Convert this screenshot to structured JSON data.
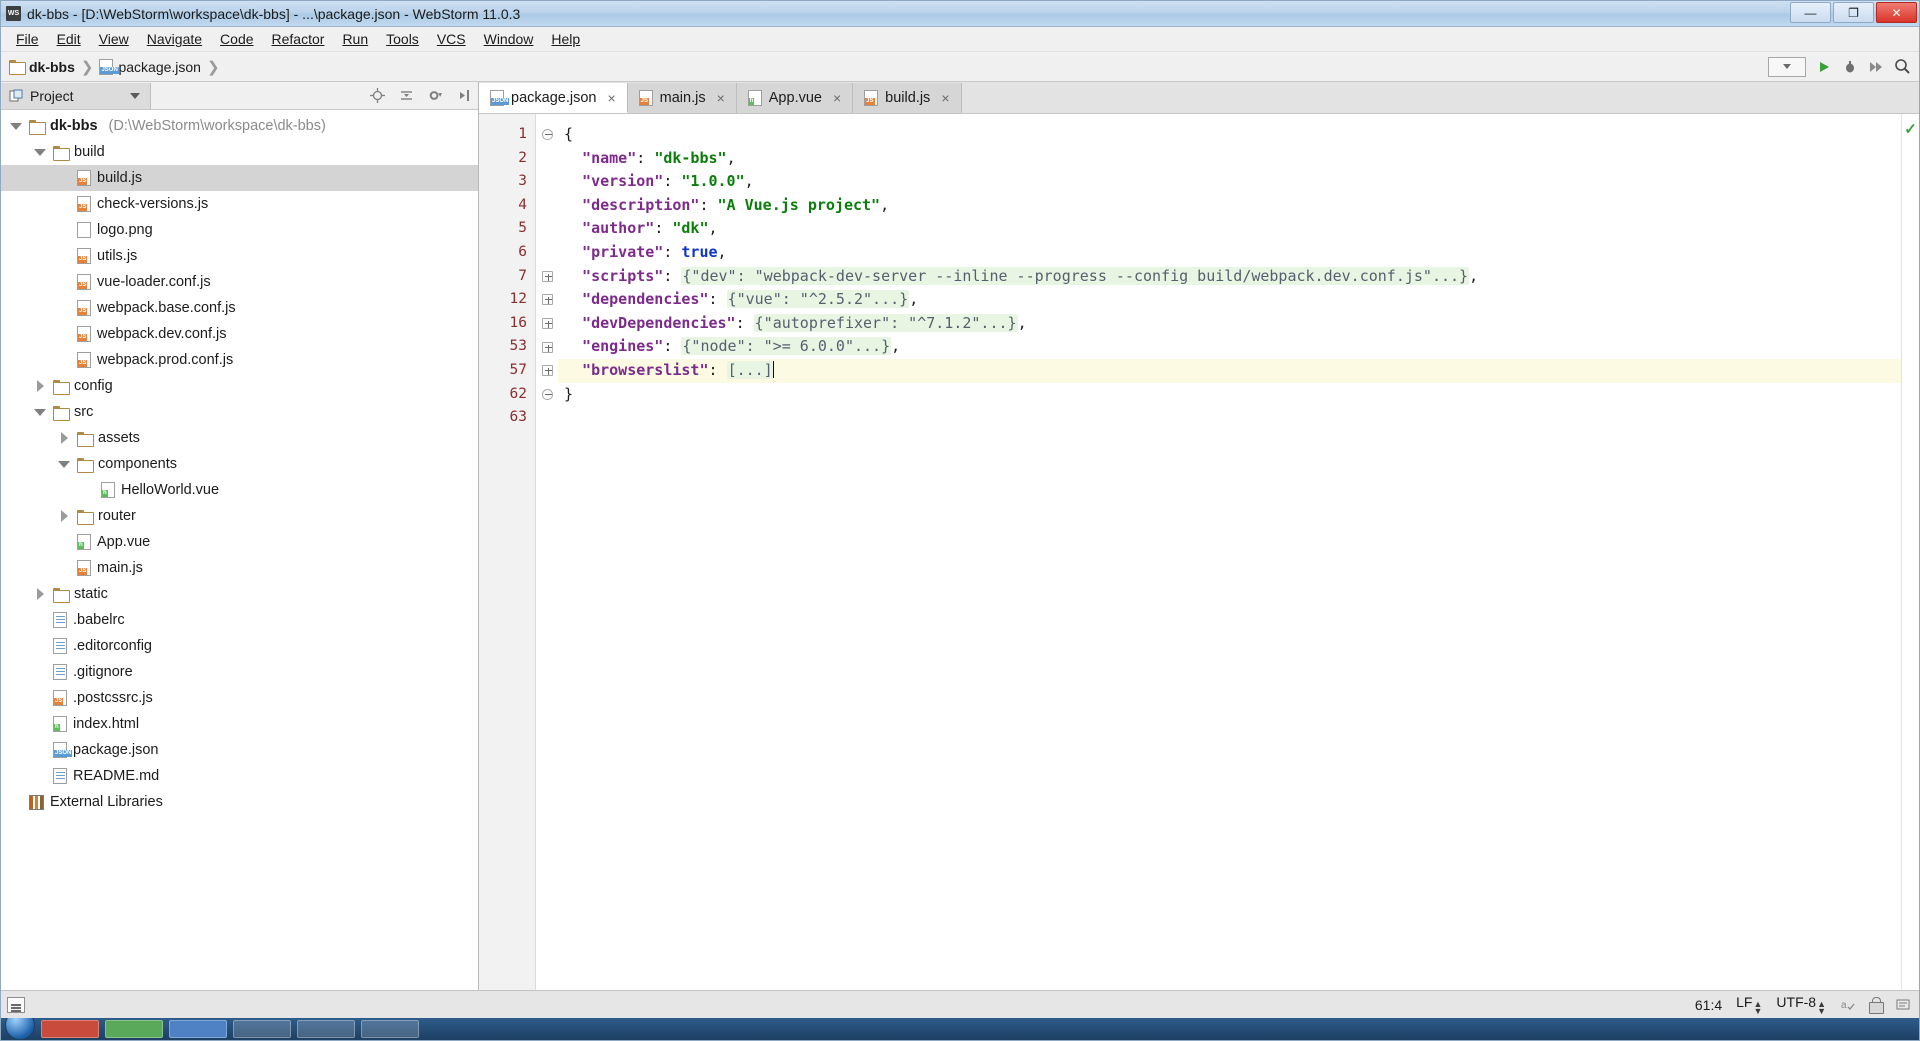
{
  "window": {
    "title": "dk-bbs - [D:\\WebStorm\\workspace\\dk-bbs] - ...\\package.json - WebStorm 11.0.3",
    "logo_text": "WS",
    "minimize_label": "—",
    "maximize_label": "❐",
    "close_label": "✕"
  },
  "menu": {
    "items": [
      {
        "label": "File"
      },
      {
        "label": "Edit"
      },
      {
        "label": "View"
      },
      {
        "label": "Navigate"
      },
      {
        "label": "Code"
      },
      {
        "label": "Refactor"
      },
      {
        "label": "Run"
      },
      {
        "label": "Tools"
      },
      {
        "label": "VCS"
      },
      {
        "label": "Window"
      },
      {
        "label": "Help"
      }
    ]
  },
  "navbar": {
    "crumbs": [
      {
        "label": "dk-bbs",
        "icon": "folder-icon"
      },
      {
        "label": "package.json",
        "icon": "json-file-icon"
      }
    ],
    "separator": "❯",
    "search_icon": "search-icon",
    "run_icon": "run-icon",
    "debug_icon": "debug-icon",
    "coverage_icon": "coverage-icon"
  },
  "project_panel": {
    "tab_label": "Project",
    "header_icons": [
      "target-icon",
      "collapse-all-icon",
      "settings-icon",
      "hide-icon"
    ],
    "tree": [
      {
        "label": "dk-bbs",
        "path": "(D:\\WebStorm\\workspace\\dk-bbs)",
        "indent": 0,
        "twisty": "down",
        "icon": "folder-icon",
        "bold": true,
        "selected": false
      },
      {
        "label": "build",
        "path": "",
        "indent": 1,
        "twisty": "down",
        "icon": "folder-icon",
        "bold": false,
        "selected": false
      },
      {
        "label": "build.js",
        "path": "",
        "indent": 2,
        "twisty": "none",
        "icon": "js-file-icon",
        "bold": false,
        "selected": true
      },
      {
        "label": "check-versions.js",
        "path": "",
        "indent": 2,
        "twisty": "none",
        "icon": "js-file-icon",
        "bold": false,
        "selected": false
      },
      {
        "label": "logo.png",
        "path": "",
        "indent": 2,
        "twisty": "none",
        "icon": "png-file-icon",
        "bold": false,
        "selected": false
      },
      {
        "label": "utils.js",
        "path": "",
        "indent": 2,
        "twisty": "none",
        "icon": "js-file-icon",
        "bold": false,
        "selected": false
      },
      {
        "label": "vue-loader.conf.js",
        "path": "",
        "indent": 2,
        "twisty": "none",
        "icon": "js-file-icon",
        "bold": false,
        "selected": false
      },
      {
        "label": "webpack.base.conf.js",
        "path": "",
        "indent": 2,
        "twisty": "none",
        "icon": "js-file-icon",
        "bold": false,
        "selected": false
      },
      {
        "label": "webpack.dev.conf.js",
        "path": "",
        "indent": 2,
        "twisty": "none",
        "icon": "js-file-icon",
        "bold": false,
        "selected": false
      },
      {
        "label": "webpack.prod.conf.js",
        "path": "",
        "indent": 2,
        "twisty": "none",
        "icon": "js-file-icon",
        "bold": false,
        "selected": false
      },
      {
        "label": "config",
        "path": "",
        "indent": 1,
        "twisty": "right",
        "icon": "folder-icon",
        "bold": false,
        "selected": false
      },
      {
        "label": "src",
        "path": "",
        "indent": 1,
        "twisty": "down",
        "icon": "folder-icon",
        "bold": false,
        "selected": false
      },
      {
        "label": "assets",
        "path": "",
        "indent": 2,
        "twisty": "right",
        "icon": "folder-icon",
        "bold": false,
        "selected": false
      },
      {
        "label": "components",
        "path": "",
        "indent": 2,
        "twisty": "down",
        "icon": "folder-icon",
        "bold": false,
        "selected": false
      },
      {
        "label": "HelloWorld.vue",
        "path": "",
        "indent": 3,
        "twisty": "none",
        "icon": "vue-file-icon",
        "bold": false,
        "selected": false
      },
      {
        "label": "router",
        "path": "",
        "indent": 2,
        "twisty": "right",
        "icon": "folder-icon",
        "bold": false,
        "selected": false
      },
      {
        "label": "App.vue",
        "path": "",
        "indent": 2,
        "twisty": "none",
        "icon": "vue-file-icon",
        "bold": false,
        "selected": false
      },
      {
        "label": "main.js",
        "path": "",
        "indent": 2,
        "twisty": "none",
        "icon": "js-file-icon",
        "bold": false,
        "selected": false
      },
      {
        "label": "static",
        "path": "",
        "indent": 1,
        "twisty": "right",
        "icon": "folder-icon",
        "bold": false,
        "selected": false
      },
      {
        "label": ".babelrc",
        "path": "",
        "indent": 1,
        "twisty": "none",
        "icon": "text-file-icon",
        "bold": false,
        "selected": false
      },
      {
        "label": ".editorconfig",
        "path": "",
        "indent": 1,
        "twisty": "none",
        "icon": "text-file-icon",
        "bold": false,
        "selected": false
      },
      {
        "label": ".gitignore",
        "path": "",
        "indent": 1,
        "twisty": "none",
        "icon": "text-file-icon",
        "bold": false,
        "selected": false
      },
      {
        "label": ".postcssrc.js",
        "path": "",
        "indent": 1,
        "twisty": "none",
        "icon": "js-file-icon",
        "bold": false,
        "selected": false
      },
      {
        "label": "index.html",
        "path": "",
        "indent": 1,
        "twisty": "none",
        "icon": "html-file-icon",
        "bold": false,
        "selected": false
      },
      {
        "label": "package.json",
        "path": "",
        "indent": 1,
        "twisty": "none",
        "icon": "json-file-icon",
        "bold": false,
        "selected": false
      },
      {
        "label": "README.md",
        "path": "",
        "indent": 1,
        "twisty": "none",
        "icon": "text-file-icon",
        "bold": false,
        "selected": false
      },
      {
        "label": "External Libraries",
        "path": "",
        "indent": 0,
        "twisty": "none",
        "icon": "library-icon",
        "bold": false,
        "selected": false
      }
    ]
  },
  "editor": {
    "tabs": [
      {
        "label": "package.json",
        "icon": "json-file-icon",
        "active": true,
        "close": "×"
      },
      {
        "label": "main.js",
        "icon": "js-file-icon",
        "active": false,
        "close": "×"
      },
      {
        "label": "App.vue",
        "icon": "vue-file-icon",
        "active": false,
        "close": "×"
      },
      {
        "label": "build.js",
        "icon": "js-file-icon",
        "active": false,
        "close": "×"
      }
    ],
    "inspection_status": "✓",
    "lines": [
      {
        "num": "1",
        "fold": "minus",
        "caret_line": false,
        "tokens": [
          {
            "t": "{",
            "c": "p"
          }
        ]
      },
      {
        "num": "2",
        "fold": "none",
        "caret_line": false,
        "tokens": [
          {
            "t": "  \"name\"",
            "c": "k"
          },
          {
            "t": ": ",
            "c": "p"
          },
          {
            "t": "\"dk-bbs\"",
            "c": "s"
          },
          {
            "t": ",",
            "c": "p"
          }
        ]
      },
      {
        "num": "3",
        "fold": "none",
        "caret_line": false,
        "tokens": [
          {
            "t": "  \"version\"",
            "c": "k"
          },
          {
            "t": ": ",
            "c": "p"
          },
          {
            "t": "\"1.0.0\"",
            "c": "s"
          },
          {
            "t": ",",
            "c": "p"
          }
        ]
      },
      {
        "num": "4",
        "fold": "none",
        "caret_line": false,
        "tokens": [
          {
            "t": "  \"description\"",
            "c": "k"
          },
          {
            "t": ": ",
            "c": "p"
          },
          {
            "t": "\"A Vue.js project\"",
            "c": "s"
          },
          {
            "t": ",",
            "c": "p"
          }
        ]
      },
      {
        "num": "5",
        "fold": "none",
        "caret_line": false,
        "tokens": [
          {
            "t": "  \"author\"",
            "c": "k"
          },
          {
            "t": ": ",
            "c": "p"
          },
          {
            "t": "\"dk\"",
            "c": "s"
          },
          {
            "t": ",",
            "c": "p"
          }
        ]
      },
      {
        "num": "6",
        "fold": "none",
        "caret_line": false,
        "tokens": [
          {
            "t": "  \"private\"",
            "c": "k"
          },
          {
            "t": ": ",
            "c": "p"
          },
          {
            "t": "true",
            "c": "b"
          },
          {
            "t": ",",
            "c": "p"
          }
        ]
      },
      {
        "num": "7",
        "fold": "plus",
        "caret_line": false,
        "tokens": [
          {
            "t": "  \"scripts\"",
            "c": "k"
          },
          {
            "t": ": ",
            "c": "p"
          },
          {
            "t": "{\"dev\": \"webpack-dev-server --inline --progress --config build/webpack.dev.conf.js\"...}",
            "c": "fold"
          },
          {
            "t": ",",
            "c": "p"
          }
        ]
      },
      {
        "num": "12",
        "fold": "plus",
        "caret_line": false,
        "tokens": [
          {
            "t": "  \"dependencies\"",
            "c": "k"
          },
          {
            "t": ": ",
            "c": "p"
          },
          {
            "t": "{\"vue\": \"^2.5.2\"...}",
            "c": "fold"
          },
          {
            "t": ",",
            "c": "p"
          }
        ]
      },
      {
        "num": "16",
        "fold": "plus",
        "caret_line": false,
        "tokens": [
          {
            "t": "  \"devDependencies\"",
            "c": "k"
          },
          {
            "t": ": ",
            "c": "p"
          },
          {
            "t": "{\"autoprefixer\": \"^7.1.2\"...}",
            "c": "fold"
          },
          {
            "t": ",",
            "c": "p"
          }
        ]
      },
      {
        "num": "53",
        "fold": "plus",
        "caret_line": false,
        "tokens": [
          {
            "t": "  \"engines\"",
            "c": "k"
          },
          {
            "t": ": ",
            "c": "p"
          },
          {
            "t": "{\"node\": \">= 6.0.0\"...}",
            "c": "fold"
          },
          {
            "t": ",",
            "c": "p"
          }
        ]
      },
      {
        "num": "57",
        "fold": "plus",
        "caret_line": true,
        "tokens": [
          {
            "t": "  \"browserslist\"",
            "c": "k"
          },
          {
            "t": ": ",
            "c": "p"
          },
          {
            "t": "[...]",
            "c": "fold"
          }
        ]
      },
      {
        "num": "62",
        "fold": "minus",
        "caret_line": false,
        "tokens": [
          {
            "t": "}",
            "c": "p"
          }
        ]
      },
      {
        "num": "63",
        "fold": "none",
        "caret_line": false,
        "tokens": []
      }
    ]
  },
  "statusbar": {
    "toggle_icon": "toggle-sidebar-icon",
    "caret_position": "61:4",
    "line_separator": "LF",
    "encoding": "UTF-8",
    "spell_icon": "spellcheck-icon",
    "lock_icon": "lock-icon",
    "event_icon": "event-log-icon"
  },
  "colors": {
    "key": "#7d2a8c",
    "string": "#0a7d0a",
    "boolean": "#0f35c8",
    "fold_background": "#e8f5e3",
    "caret_line": "#fcfae3",
    "selection": "#d4d4d4",
    "title_accent": "#aac9e5"
  }
}
